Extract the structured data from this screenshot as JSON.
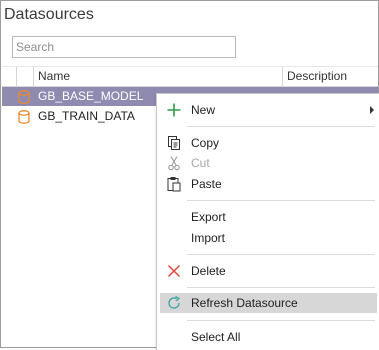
{
  "panel": {
    "title": "Datasources"
  },
  "search": {
    "placeholder": "Search",
    "value": ""
  },
  "grid": {
    "columns": [
      "Name",
      "Description"
    ],
    "rows": [
      {
        "name": "GB_BASE_MODEL",
        "selected": true
      },
      {
        "name": "GB_TRAIN_DATA",
        "selected": false
      }
    ]
  },
  "menu": {
    "items": [
      {
        "label": "New",
        "icon": "plus-icon",
        "submenu": true
      },
      {
        "label": "Copy",
        "icon": "copy-icon"
      },
      {
        "label": "Cut",
        "icon": "scissors-icon",
        "disabled": true
      },
      {
        "label": "Paste",
        "icon": "paste-icon"
      },
      {
        "label": "Export"
      },
      {
        "label": "Import"
      },
      {
        "label": "Delete",
        "icon": "delete-x-icon"
      },
      {
        "label": "Refresh Datasource",
        "icon": "refresh-icon",
        "highlighted": true
      },
      {
        "label": "Select All"
      }
    ]
  },
  "colors": {
    "selection": "#8f8ab0",
    "db_icon": "#e8892c",
    "new_icon": "#2e9a4a",
    "delete_icon": "#e0453b",
    "refresh_icon": "#4aa5a6",
    "hover": "#d7d7d7"
  }
}
